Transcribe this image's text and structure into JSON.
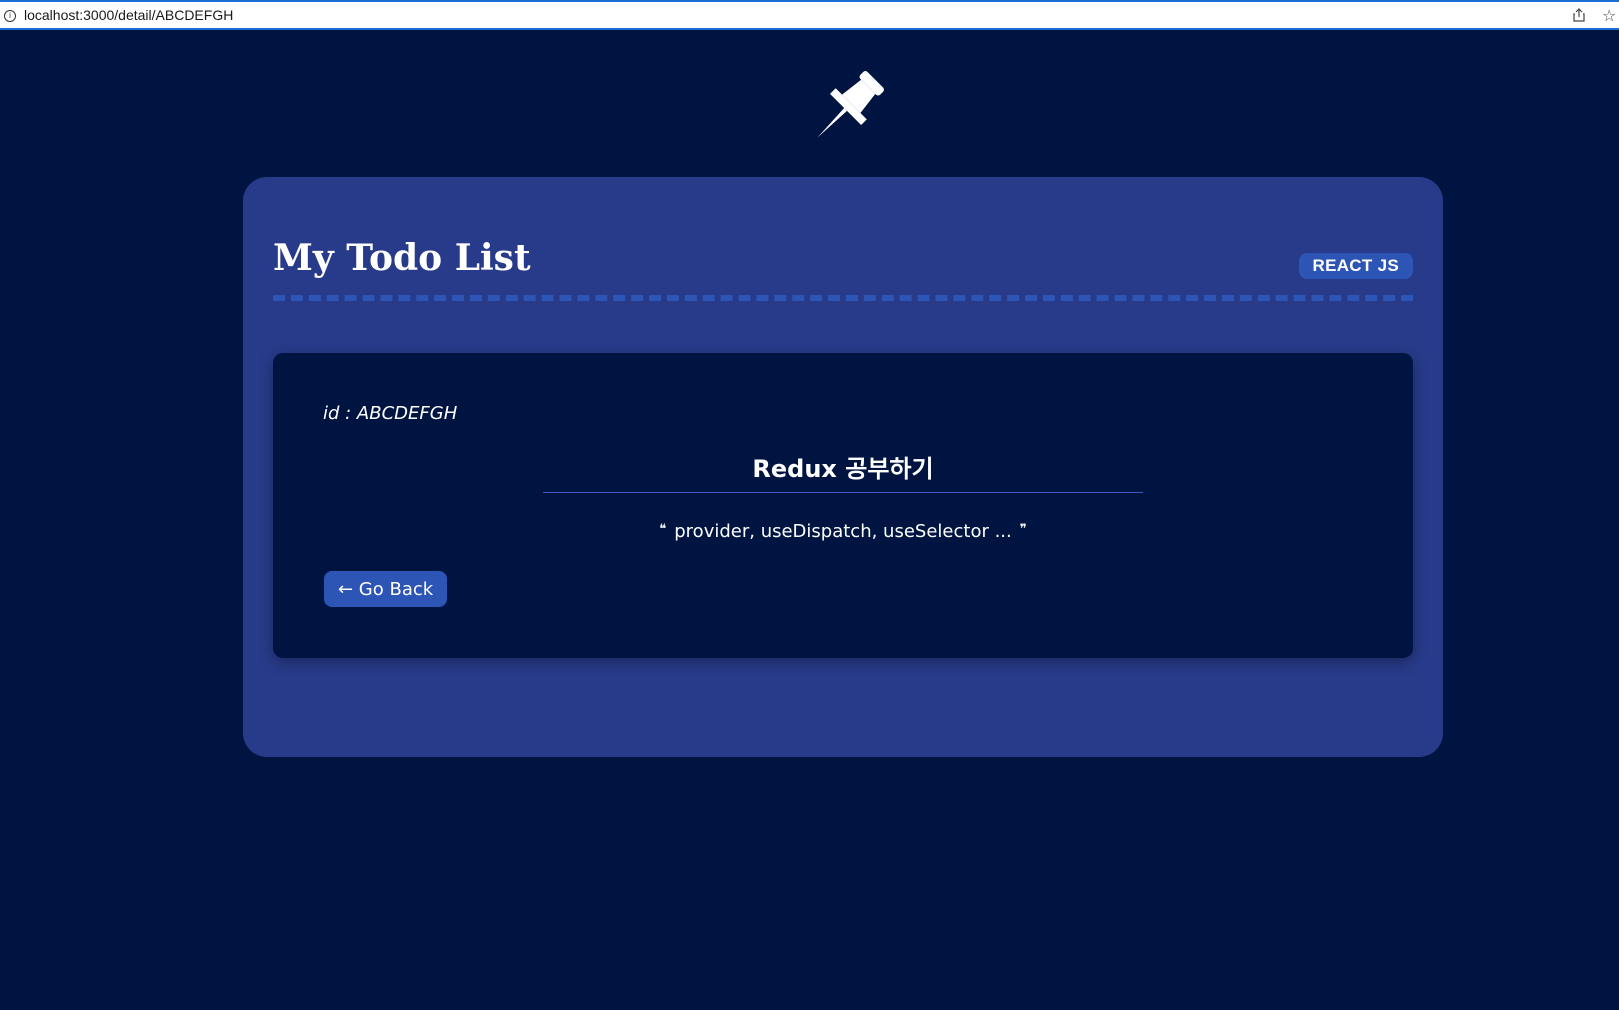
{
  "browser": {
    "url": "localhost:3000/detail/ABCDEFGH",
    "info_icon": "i"
  },
  "icons": {
    "logo": "pushpin-icon",
    "share": "share-icon",
    "bookmark": "star-icon"
  },
  "header": {
    "title": "My Todo List",
    "badge": "REACT JS"
  },
  "detail": {
    "id_line": "id : ABCDEFGH",
    "title": "Redux 공부하기",
    "body": "provider, useDispatch, useSelector ...",
    "open_quote": "❝",
    "close_quote": "❞",
    "back_label": "← Go Back"
  },
  "colors": {
    "page_background": "#001442",
    "panel_background": "#283b8a",
    "accent": "#2d55b5"
  }
}
